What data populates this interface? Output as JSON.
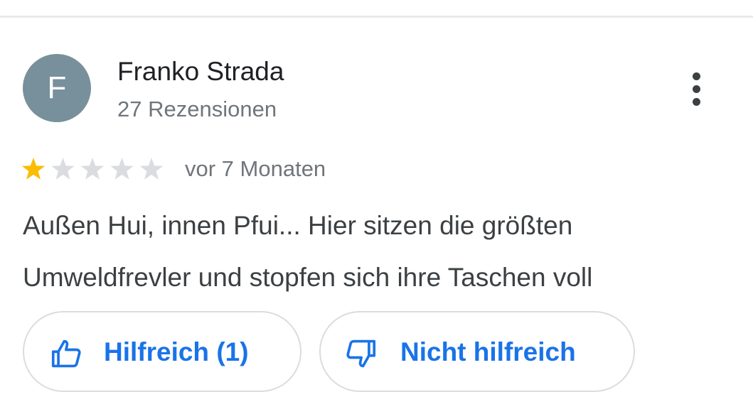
{
  "review": {
    "author": {
      "initial": "F",
      "name": "Franko Strada",
      "review_count": "27 Rezensionen",
      "avatar_color": "#78909c"
    },
    "rating": {
      "value": 1,
      "max": 5,
      "filled_color": "#fbbc04",
      "empty_color": "#dadce0"
    },
    "date": "vor 7 Monaten",
    "text": "Außen Hui, innen Pfui... Hier sitzen die größten Umweldfrevler und stopfen sich ihre Taschen voll",
    "menu_icon": "more-vertical-icon"
  },
  "actions": {
    "helpful": {
      "label": "Hilfreich (1)",
      "icon": "thumbs-up-icon"
    },
    "not_helpful": {
      "label": "Nicht hilfreich",
      "icon": "thumbs-down-icon"
    },
    "accent_color": "#1a73e8"
  }
}
